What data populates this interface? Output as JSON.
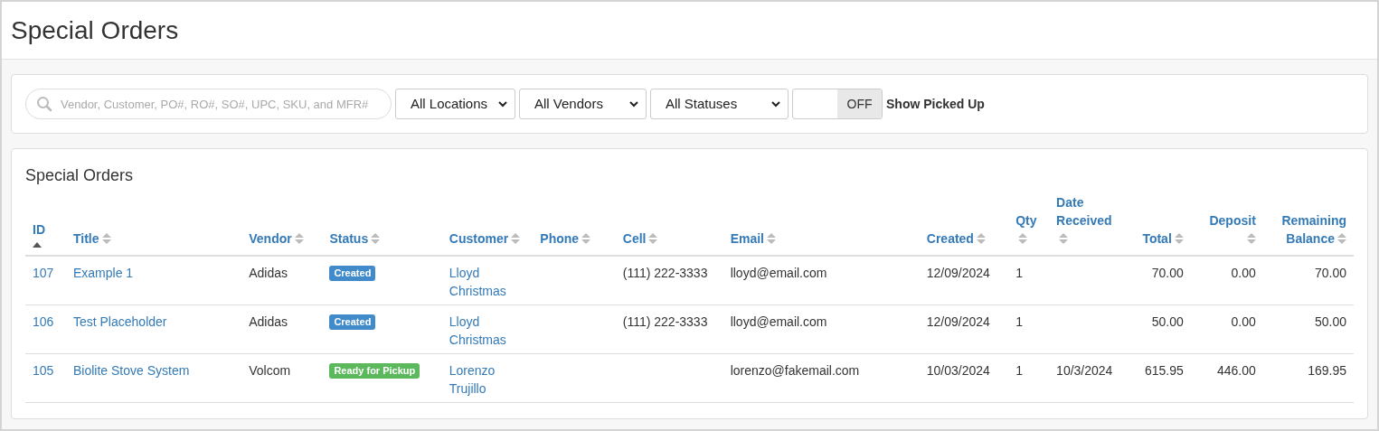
{
  "page_title": "Special Orders",
  "filters": {
    "search": {
      "placeholder": "Vendor, Customer, PO#, RO#, SO#, UPC, SKU, and MFR#"
    },
    "selects": [
      {
        "value": "All Locations"
      },
      {
        "value": "All Vendors"
      },
      {
        "value": "All Statuses"
      }
    ],
    "toggle": {
      "on": false,
      "state_text": "OFF",
      "label": "Show Picked Up"
    }
  },
  "table_title": "Special Orders",
  "columns": [
    {
      "label": "ID",
      "sorted": true,
      "kind": "text"
    },
    {
      "label": "Title",
      "sorted": false,
      "kind": "text"
    },
    {
      "label": "Vendor",
      "sorted": false,
      "kind": "text"
    },
    {
      "label": "Status",
      "sorted": false,
      "kind": "text"
    },
    {
      "label": "Customer",
      "sorted": false,
      "kind": "text"
    },
    {
      "label": "Phone",
      "sorted": false,
      "kind": "text"
    },
    {
      "label": "Cell",
      "sorted": false,
      "kind": "text"
    },
    {
      "label": "Email",
      "sorted": false,
      "kind": "text"
    },
    {
      "label": "Created",
      "sorted": false,
      "kind": "text"
    },
    {
      "label": "Qty",
      "sorted": false,
      "kind": "text"
    },
    {
      "label": "Date Received",
      "sorted": false,
      "kind": "text"
    },
    {
      "label": "Total",
      "sorted": false,
      "kind": "amount"
    },
    {
      "label": "Deposit",
      "sorted": false,
      "kind": "amount"
    },
    {
      "label": "Remaining Balance",
      "sorted": false,
      "kind": "amount"
    }
  ],
  "rows": [
    {
      "id": "107",
      "title": "Example 1",
      "vendor": "Adidas",
      "status": {
        "text": "Created",
        "color": "#428bca"
      },
      "customer": "Lloyd Christmas",
      "cell": "(111) 222-3333",
      "email": "lloyd@email.com",
      "created": "12/09/2024",
      "qty": "1",
      "total": "70.00",
      "deposit": "0.00",
      "remaining": "70.00"
    },
    {
      "id": "106",
      "title": "Test Placeholder",
      "vendor": "Adidas",
      "status": {
        "text": "Created",
        "color": "#428bca"
      },
      "customer": "Lloyd Christmas",
      "cell": "(111) 222-3333",
      "email": "lloyd@email.com",
      "created": "12/09/2024",
      "qty": "1",
      "total": "50.00",
      "deposit": "0.00",
      "remaining": "50.00"
    },
    {
      "id": "105",
      "title": "Biolite Stove System",
      "vendor": "Volcom",
      "status": {
        "text": "Ready for Pickup",
        "color": "#5cb85c"
      },
      "customer": "Lorenzo Trujillo",
      "email": "lorenzo@fakemail.com",
      "created": "10/03/2024",
      "qty": "1",
      "date_received": "10/3/2024",
      "total": "615.95",
      "deposit": "446.00",
      "remaining": "169.95"
    }
  ]
}
